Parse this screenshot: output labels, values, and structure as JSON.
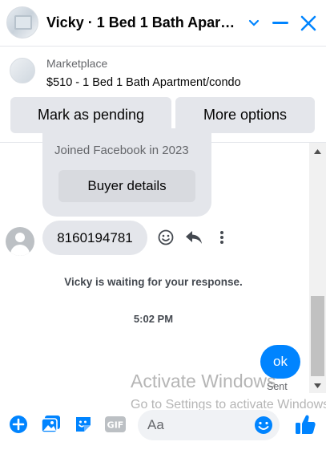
{
  "header": {
    "title": "Vicky · 1 Bed 1 Bath Apart…",
    "avatar_icon": "listing-photo-avatar",
    "chevron_icon": "chevron-down-icon",
    "minimize_icon": "minimize-icon",
    "close_icon": "close-icon"
  },
  "marketplace": {
    "source": "Marketplace",
    "listing": "$510 - 1 Bed 1 Bath Apartment/condo",
    "mark_pending_label": "Mark as pending",
    "more_options_label": "More options"
  },
  "chat": {
    "joined_text": "Joined Facebook in 2023",
    "buyer_details_label": "Buyer details",
    "incoming_message": "8160194781",
    "waiting_text": "Vicky is waiting for your response.",
    "timestamp": "5:02 PM",
    "outgoing_message": "ok",
    "sent_status": "Sent"
  },
  "watermark": {
    "title": "Activate Windows",
    "subtitle": "Go to Settings to activate Windows."
  },
  "composer": {
    "placeholder": "Aa",
    "gif_label": "GIF"
  },
  "colors": {
    "accent": "#0084ff",
    "bubble": "#e4e6eb",
    "muted_text": "#65676b"
  }
}
